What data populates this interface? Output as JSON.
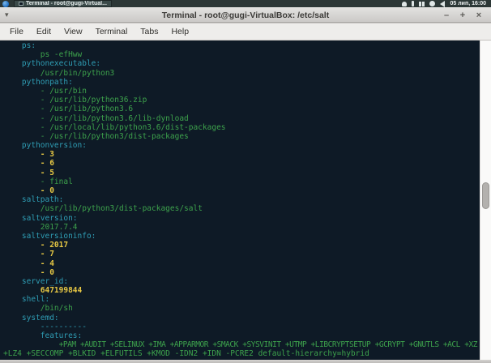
{
  "panel": {
    "app_icon": "application-menu-icon",
    "task_button_label": "Terminal - root@gugi-Virtual...",
    "tray_icons": [
      "bell-icon",
      "bluetooth-icon",
      "network-arrows-icon",
      "notification-icon",
      "volume-icon"
    ],
    "clock": "05 лип, 16:00"
  },
  "window": {
    "title": "Terminal - root@gugi-VirtualBox: /etc/salt",
    "shade_arrow": "▾",
    "minimize_label": "–",
    "maximize_label": "+",
    "close_label": "×"
  },
  "menubar": {
    "items": [
      "File",
      "Edit",
      "View",
      "Terminal",
      "Tabs",
      "Help"
    ]
  },
  "terminal": {
    "colors": {
      "background": "#0e1a26",
      "key": "#2f9db4",
      "string": "#3da24c",
      "number": "#e8c944"
    },
    "lines": [
      {
        "text": "ps:",
        "color": "key",
        "indent": 1
      },
      {
        "text": "ps -efHww",
        "color": "str",
        "indent": 2
      },
      {
        "text": "pythonexecutable:",
        "color": "key",
        "indent": 1
      },
      {
        "text": "/usr/bin/python3",
        "color": "str",
        "indent": 2
      },
      {
        "text": "pythonpath:",
        "color": "key",
        "indent": 1
      },
      {
        "text": "- /usr/bin",
        "color": "str",
        "indent": 2
      },
      {
        "text": "- /usr/lib/python36.zip",
        "color": "str",
        "indent": 2
      },
      {
        "text": "- /usr/lib/python3.6",
        "color": "str",
        "indent": 2
      },
      {
        "text": "- /usr/lib/python3.6/lib-dynload",
        "color": "str",
        "indent": 2
      },
      {
        "text": "- /usr/local/lib/python3.6/dist-packages",
        "color": "str",
        "indent": 2
      },
      {
        "text": "- /usr/lib/python3/dist-packages",
        "color": "str",
        "indent": 2
      },
      {
        "text": "pythonversion:",
        "color": "key",
        "indent": 1
      },
      {
        "text": "- 3",
        "color": "num",
        "indent": 2
      },
      {
        "text": "- 6",
        "color": "num",
        "indent": 2
      },
      {
        "text": "- 5",
        "color": "num",
        "indent": 2
      },
      {
        "text": "- final",
        "color": "str",
        "indent": 2
      },
      {
        "text": "- 0",
        "color": "num",
        "indent": 2
      },
      {
        "text": "saltpath:",
        "color": "key",
        "indent": 1
      },
      {
        "text": "/usr/lib/python3/dist-packages/salt",
        "color": "str",
        "indent": 2
      },
      {
        "text": "saltversion:",
        "color": "key",
        "indent": 1
      },
      {
        "text": "2017.7.4",
        "color": "str",
        "indent": 2
      },
      {
        "text": "saltversioninfo:",
        "color": "key",
        "indent": 1
      },
      {
        "text": "- 2017",
        "color": "num",
        "indent": 2
      },
      {
        "text": "- 7",
        "color": "num",
        "indent": 2
      },
      {
        "text": "- 4",
        "color": "num",
        "indent": 2
      },
      {
        "text": "- 0",
        "color": "num",
        "indent": 2
      },
      {
        "text": "server_id:",
        "color": "key",
        "indent": 1
      },
      {
        "text": "647199844",
        "color": "num",
        "indent": 2
      },
      {
        "text": "shell:",
        "color": "key",
        "indent": 1
      },
      {
        "text": "/bin/sh",
        "color": "str",
        "indent": 2
      },
      {
        "text": "systemd:",
        "color": "key",
        "indent": 1
      },
      {
        "text": "----------",
        "color": "key",
        "indent": 2
      },
      {
        "text": "features:",
        "color": "key",
        "indent": 2
      },
      {
        "text": "+PAM +AUDIT +SELINUX +IMA +APPARMOR +SMACK +SYSVINIT +UTMP +LIBCRYPTSETUP +GCRYPT +GNUTLS +ACL +XZ",
        "color": "str",
        "indent": 3,
        "tight": true
      },
      {
        "text": "+LZ4 +SECCOMP +BLKID +ELFUTILS +KMOD -IDN2 +IDN -PCRE2 default-hierarchy=hybrid",
        "color": "str",
        "indent": 0
      }
    ]
  }
}
